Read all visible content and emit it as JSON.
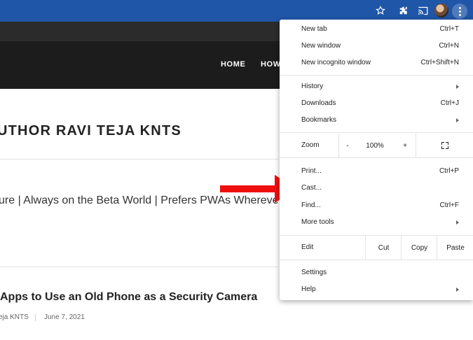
{
  "browser": {
    "toolbar_color": "#1f56a8",
    "icons": [
      "star-icon",
      "extensions-icon",
      "cast-icon",
      "avatar",
      "menu-dots-icon"
    ]
  },
  "site": {
    "nav": [
      "HOME",
      "HOW"
    ],
    "author_heading": "UTHOR RAVI TEJA KNTS",
    "bio": "ure | Always on the Beta World | Prefers PWAs Whereve",
    "post_title": "Apps to Use an Old Phone as a Security Camera",
    "post_author": "eja KNTS",
    "post_date": "June 7, 2021"
  },
  "menu": {
    "group1": [
      {
        "label": "New tab",
        "shortcut": "Ctrl+T"
      },
      {
        "label": "New window",
        "shortcut": "Ctrl+N"
      },
      {
        "label": "New incognito window",
        "shortcut": "Ctrl+Shift+N"
      }
    ],
    "group2": [
      {
        "label": "History",
        "shortcut": ""
      },
      {
        "label": "Downloads",
        "shortcut": "Ctrl+J"
      },
      {
        "label": "Bookmarks",
        "shortcut": ""
      }
    ],
    "zoom": {
      "label": "Zoom",
      "minus": "-",
      "value": "100%",
      "plus": "+"
    },
    "group3": [
      {
        "label": "Print...",
        "shortcut": "Ctrl+P"
      },
      {
        "label": "Cast...",
        "shortcut": ""
      },
      {
        "label": "Find...",
        "shortcut": "Ctrl+F"
      },
      {
        "label": "More tools",
        "shortcut": ""
      }
    ],
    "edit": {
      "label": "Edit",
      "cut": "Cut",
      "copy": "Copy",
      "paste": "Paste"
    },
    "group4": [
      {
        "label": "Settings",
        "shortcut": ""
      },
      {
        "label": "Help",
        "shortcut": ""
      }
    ]
  },
  "annotation_color": "#f00f0f"
}
